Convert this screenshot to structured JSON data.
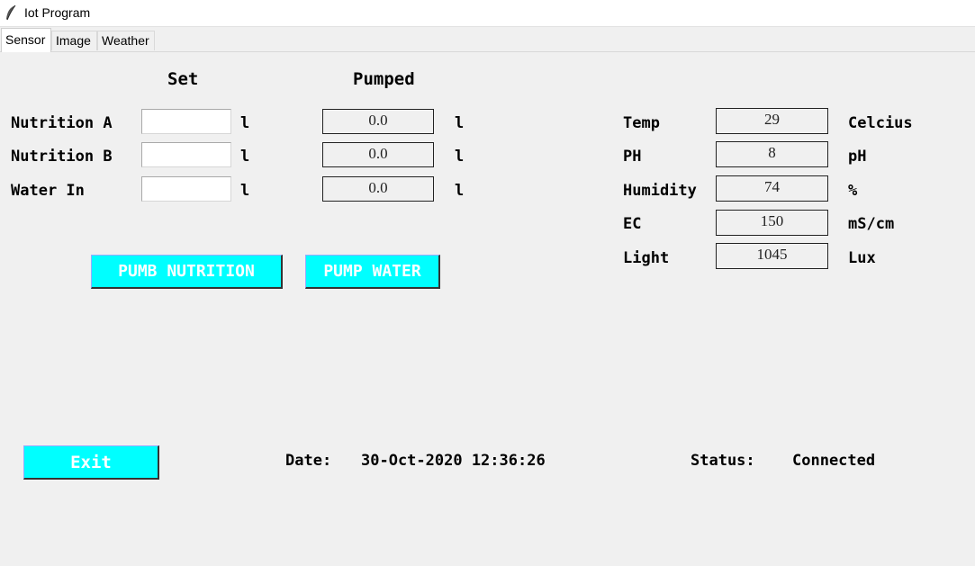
{
  "window": {
    "title": "Iot Program",
    "icon": "feather-icon"
  },
  "tabs": [
    {
      "label": "Sensor",
      "active": true
    },
    {
      "label": "Image",
      "active": false
    },
    {
      "label": "Weather",
      "active": false
    }
  ],
  "pumps": {
    "header_set": "Set",
    "header_pumped": "Pumped",
    "rows": [
      {
        "label": "Nutrition A",
        "set_value": "",
        "set_unit": "l",
        "pumped_value": "0.0",
        "pumped_unit": "l"
      },
      {
        "label": "Nutrition B",
        "set_value": "",
        "set_unit": "l",
        "pumped_value": "0.0",
        "pumped_unit": "l"
      },
      {
        "label": "Water In",
        "set_value": "",
        "set_unit": "l",
        "pumped_value": "0.0",
        "pumped_unit": "l"
      }
    ],
    "pump_nutrition_label": "PUMB NUTRITION",
    "pump_water_label": "PUMP WATER"
  },
  "sensors": [
    {
      "label": "Temp",
      "value": "29",
      "unit": "Celcius"
    },
    {
      "label": "PH",
      "value": "8",
      "unit": "pH"
    },
    {
      "label": "Humidity",
      "value": "74",
      "unit": "%"
    },
    {
      "label": "EC",
      "value": "150",
      "unit": "mS/cm"
    },
    {
      "label": "Light",
      "value": "1045",
      "unit": "Lux"
    }
  ],
  "footer": {
    "exit_label": "Exit",
    "date_label": "Date:",
    "date_value": "30-Oct-2020 12:36:26",
    "status_label": "Status:",
    "status_value": "Connected"
  },
  "colors": {
    "button_bg": "#00ffff",
    "button_text": "#ffffff",
    "window_bg": "#f0f0f0"
  }
}
